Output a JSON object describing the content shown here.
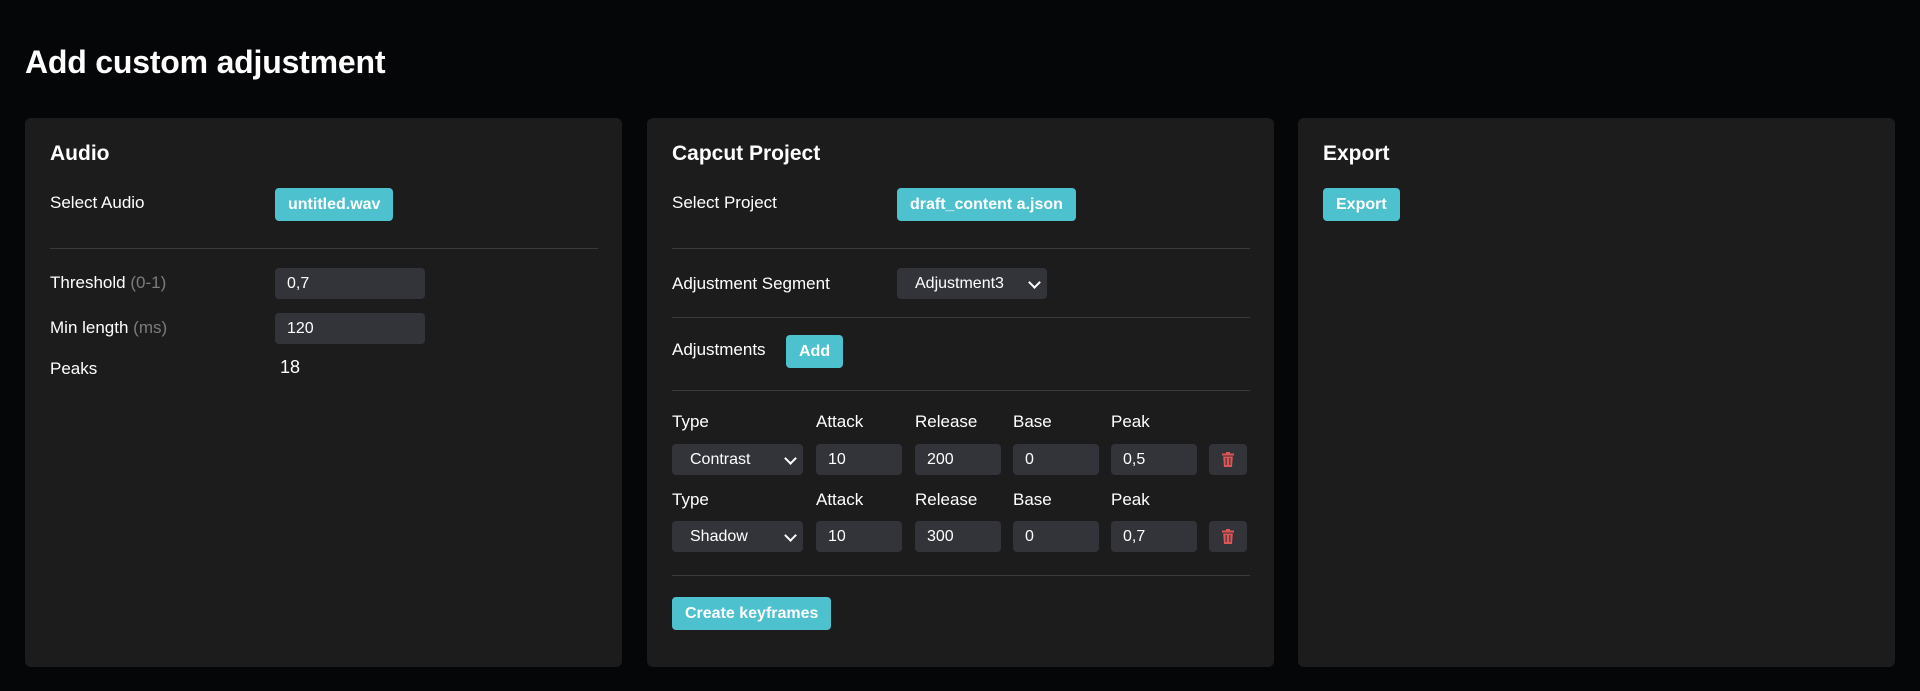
{
  "page": {
    "title": "Add custom adjustment"
  },
  "audio": {
    "title": "Audio",
    "select_label": "Select Audio",
    "file_button": "untitled.wav",
    "threshold_label": "Threshold",
    "threshold_hint": "(0-1)",
    "threshold_value": "0,7",
    "min_length_label": "Min length",
    "min_length_hint": "(ms)",
    "min_length_value": "120",
    "peaks_label": "Peaks",
    "peaks_value": "18"
  },
  "project": {
    "title": "Capcut Project",
    "select_label": "Select Project",
    "file_button": "draft_content a.json",
    "segment_label": "Adjustment Segment",
    "segment_value": "Adjustment3",
    "adjustments_label": "Adjustments",
    "add_button": "Add",
    "columns": {
      "type": "Type",
      "attack": "Attack",
      "release": "Release",
      "base": "Base",
      "peak": "Peak"
    },
    "rows": [
      {
        "type": "Contrast",
        "attack": "10",
        "release": "200",
        "base": "0",
        "peak": "0,5"
      },
      {
        "type": "Shadow",
        "attack": "10",
        "release": "300",
        "base": "0",
        "peak": "0,7"
      }
    ],
    "create_button": "Create keyframes"
  },
  "export": {
    "title": "Export",
    "export_button": "Export"
  },
  "colors": {
    "accent": "#4ec1ce",
    "panel": "#1c1c1c",
    "background": "#050608",
    "input": "#33343a",
    "danger": "#e05555"
  }
}
